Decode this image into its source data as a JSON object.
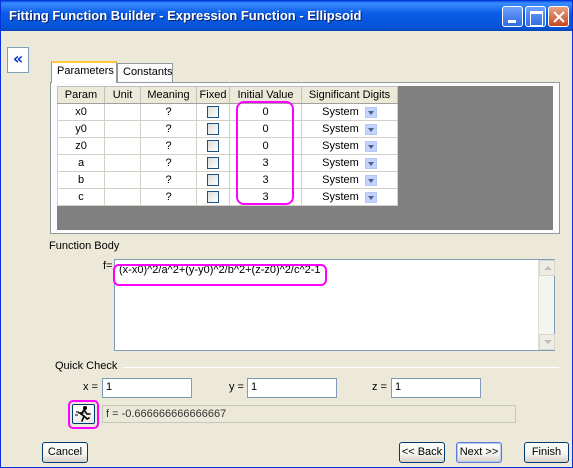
{
  "window": {
    "title": "Fitting Function Builder - Expression Function - Ellipsoid"
  },
  "sidebar": {
    "collapse_label": "«"
  },
  "tabs": [
    {
      "label": "Parameters",
      "active": true
    },
    {
      "label": "Constants",
      "active": false
    }
  ],
  "grid": {
    "headers": [
      "Param",
      "Unit",
      "Meaning",
      "Fixed",
      "Initial Value",
      "Significant Digits"
    ],
    "rows": [
      {
        "param": "x0",
        "unit": "",
        "meaning": "?",
        "fixed": false,
        "initial": "0",
        "digits": "System"
      },
      {
        "param": "y0",
        "unit": "",
        "meaning": "?",
        "fixed": false,
        "initial": "0",
        "digits": "System"
      },
      {
        "param": "z0",
        "unit": "",
        "meaning": "?",
        "fixed": false,
        "initial": "0",
        "digits": "System"
      },
      {
        "param": "a",
        "unit": "",
        "meaning": "?",
        "fixed": false,
        "initial": "3",
        "digits": "System"
      },
      {
        "param": "b",
        "unit": "",
        "meaning": "?",
        "fixed": false,
        "initial": "3",
        "digits": "System"
      },
      {
        "param": "c",
        "unit": "",
        "meaning": "?",
        "fixed": false,
        "initial": "3",
        "digits": "System"
      }
    ]
  },
  "function_body": {
    "label": "Function Body",
    "prefix": "f=",
    "expression": "(x-x0)^2/a^2+(y-y0)^2/b^2+(z-z0)^2/c^2-1"
  },
  "quick_check": {
    "label": "Quick Check",
    "x_label": "x =",
    "x_value": "1",
    "y_label": "y =",
    "y_value": "1",
    "z_label": "z =",
    "z_value": "1",
    "result": "f = -0.666666666666667"
  },
  "buttons": {
    "cancel": "Cancel",
    "back": "<< Back",
    "next": "Next >>",
    "finish": "Finish"
  },
  "colors": {
    "highlight": "#ff00ff",
    "titlebar": "#0a5de8",
    "dialog_bg": "#ece9d8"
  }
}
